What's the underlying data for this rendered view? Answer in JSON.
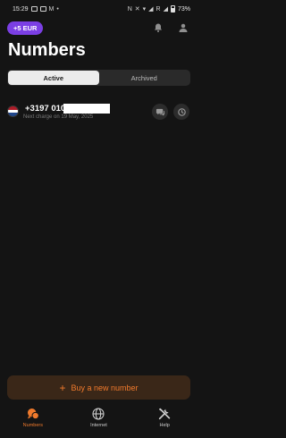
{
  "status_bar": {
    "time": "15:29",
    "indicator_letters": "N",
    "carrier_letter": "R",
    "battery_percent": "73%"
  },
  "header": {
    "balance_chip": "+5 EUR",
    "title": "Numbers"
  },
  "tabs": [
    {
      "label": "Active",
      "selected": true
    },
    {
      "label": "Archived",
      "selected": false
    }
  ],
  "numbers": [
    {
      "country_flag": "netherlands-flag",
      "number": "+3197 010",
      "next_charge": "Next charge on 19 May, 2025"
    }
  ],
  "buy_button": {
    "label": "Buy a new number",
    "icon": "plus"
  },
  "bottom_nav": [
    {
      "label": "Numbers",
      "icon": "chat-bubbles",
      "active": true
    },
    {
      "label": "Internet",
      "icon": "globe",
      "active": false
    },
    {
      "label": "Help",
      "icon": "tools",
      "active": false
    }
  ],
  "colors": {
    "background": "#141414",
    "accent_orange": "#f07a2c",
    "balance_chip_purple": "#7b3fe4",
    "tab_active": "#ececec"
  }
}
